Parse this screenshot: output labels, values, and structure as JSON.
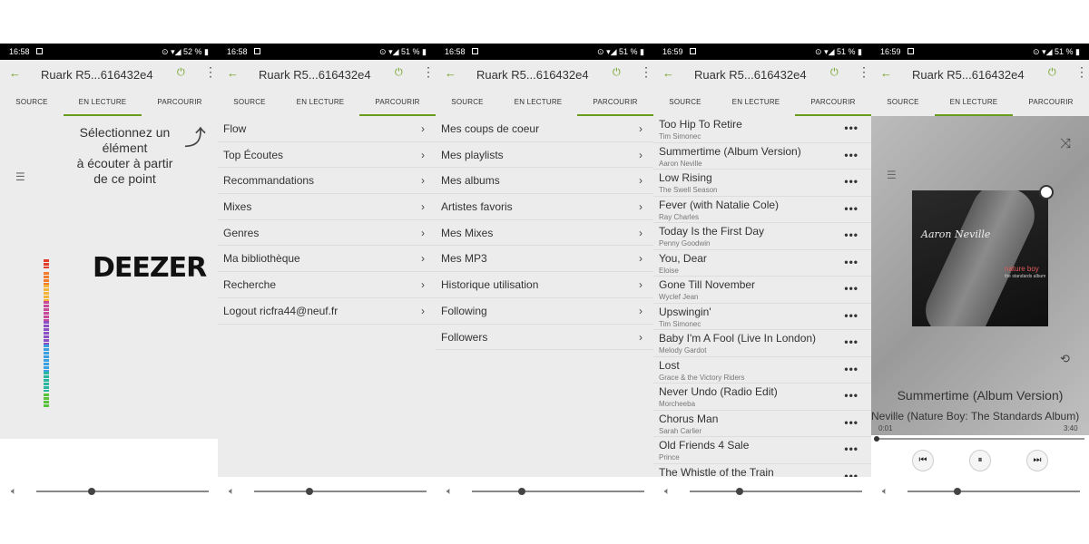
{
  "colors": {
    "accent": "#6a9c1c"
  },
  "screens": [
    {
      "status": {
        "time": "16:58",
        "battery": "52 %"
      },
      "title": "Ruark R5...616432e4",
      "tabs": [
        "SOURCE",
        "EN LECTURE",
        "PARCOURIR"
      ],
      "active_tab": "EN LECTURE",
      "hint": [
        "Sélectionnez un",
        "élément",
        "à écouter à partir",
        "de ce point"
      ],
      "logo": "DEEZER",
      "volume_level": 0.32
    },
    {
      "status": {
        "time": "16:58",
        "battery": "51 %"
      },
      "title": "Ruark R5...616432e4",
      "tabs": [
        "SOURCE",
        "EN LECTURE",
        "PARCOURIR"
      ],
      "active_tab": "PARCOURIR",
      "menu": [
        "Flow",
        "Top Écoutes",
        "Recommandations",
        "Mixes",
        "Genres",
        "Ma bibliothèque",
        "Recherche",
        "Logout ricfra44@neuf.fr"
      ],
      "volume_level": 0.32
    },
    {
      "status": {
        "time": "16:58",
        "battery": "51 %"
      },
      "title": "Ruark R5...616432e4",
      "tabs": [
        "SOURCE",
        "EN LECTURE",
        "PARCOURIR"
      ],
      "active_tab": "PARCOURIR",
      "menu": [
        "Mes coups de coeur",
        "Mes playlists",
        "Mes albums",
        "Artistes favoris",
        "Mes Mixes",
        "Mes MP3",
        "Historique utilisation",
        "Following",
        "Followers"
      ],
      "volume_level": 0.29
    },
    {
      "status": {
        "time": "16:59",
        "battery": "51 %"
      },
      "title": "Ruark R5...616432e4",
      "tabs": [
        "SOURCE",
        "EN LECTURE",
        "PARCOURIR"
      ],
      "active_tab": "PARCOURIR",
      "tracks": [
        {
          "title": "Too Hip To Retire",
          "artist": "Tim Simonec"
        },
        {
          "title": "Summertime (Album Version)",
          "artist": "Aaron Neville"
        },
        {
          "title": "Low Rising",
          "artist": "The Swell Season"
        },
        {
          "title": "Fever (with Natalie Cole)",
          "artist": "Ray Charles"
        },
        {
          "title": "Today Is the First Day",
          "artist": "Penny Goodwin"
        },
        {
          "title": "You, Dear",
          "artist": "Eloise"
        },
        {
          "title": "Gone Till November",
          "artist": "Wyclef Jean"
        },
        {
          "title": "Upswingin'",
          "artist": "Tim Simonec"
        },
        {
          "title": "Baby I'm A Fool (Live In London)",
          "artist": "Melody Gardot"
        },
        {
          "title": "Lost",
          "artist": "Grace & the Victory Riders"
        },
        {
          "title": "Never Undo (Radio Edit)",
          "artist": "Morcheeba"
        },
        {
          "title": "Chorus Man",
          "artist": "Sarah Carlier"
        },
        {
          "title": "Old Friends 4 Sale",
          "artist": "Prince"
        },
        {
          "title": "The Whistle of the Train",
          "artist": ""
        }
      ],
      "volume_level": 0.29
    },
    {
      "status": {
        "time": "16:59",
        "battery": "51 %"
      },
      "title": "Ruark R5...616432e4",
      "tabs": [
        "SOURCE",
        "EN LECTURE",
        "PARCOURIR"
      ],
      "active_tab": "EN LECTURE",
      "album_art": {
        "artist": "Aaron Neville",
        "album": "nature boy",
        "subtitle": "the standards album"
      },
      "now_playing": {
        "title": "Summertime (Album Version)",
        "subtitle": "Neville (Nature Boy: The Standards Album)",
        "elapsed": "0:01",
        "duration": "3:40",
        "progress": 0.005
      },
      "volume_level": 0.29
    }
  ]
}
